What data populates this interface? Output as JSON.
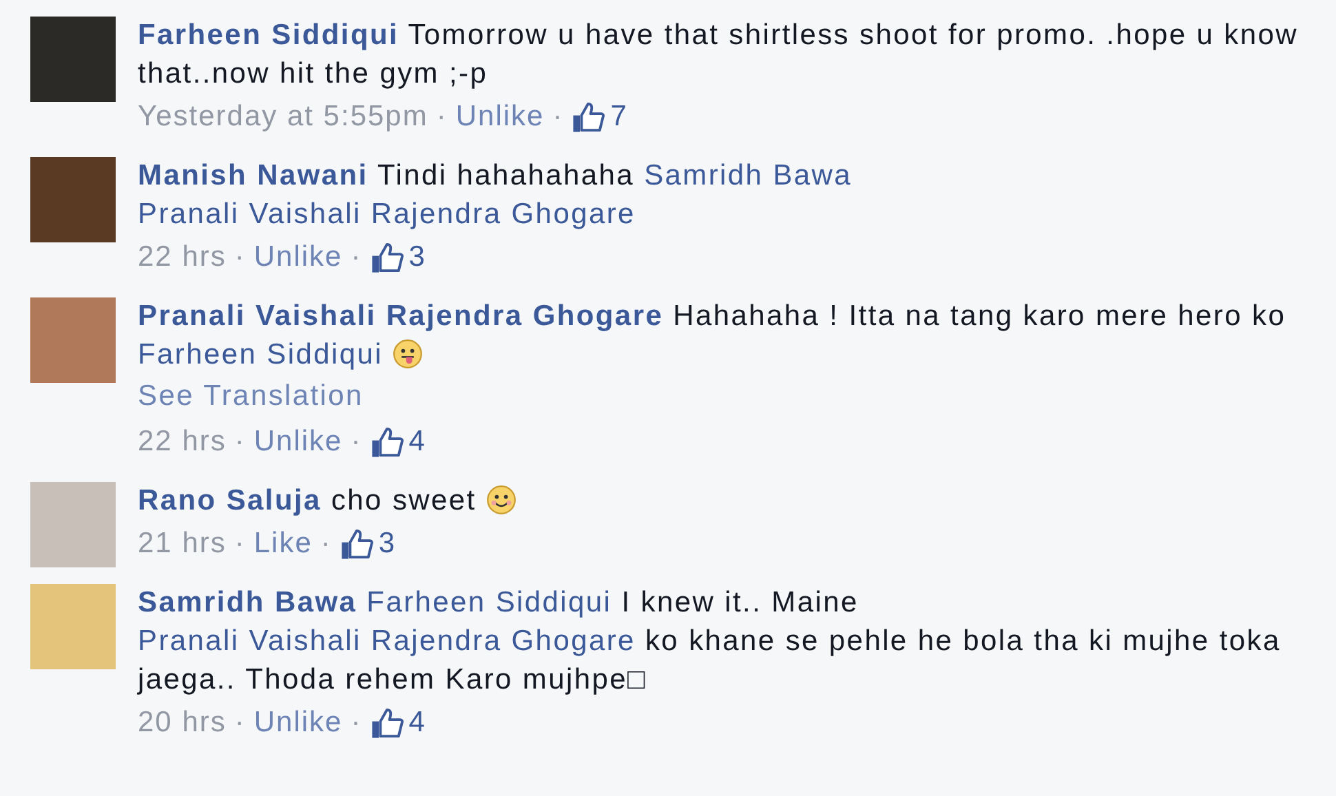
{
  "separator": "·",
  "comments": [
    {
      "author": "Farheen Siddiqui",
      "body": [
        {
          "kind": "text",
          "text": "Tomorrow u have that shirtless shoot for promo. .hope u know that..now hit the gym ;-p"
        }
      ],
      "time": "Yesterday at 5:55pm",
      "action": "Unlike",
      "likes": "7"
    },
    {
      "author": "Manish Nawani",
      "body": [
        {
          "kind": "text",
          "text": "Tindi hahahahaha"
        },
        {
          "kind": "mention",
          "text": "Samridh Bawa"
        },
        {
          "kind": "mention",
          "text": "Pranali Vaishali Rajendra Ghogare"
        }
      ],
      "time": "22 hrs",
      "action": "Unlike",
      "likes": "3"
    },
    {
      "author": "Pranali Vaishali Rajendra Ghogare",
      "body": [
        {
          "kind": "text",
          "text": "Hahahaha ! Itta na tang karo mere hero ko"
        },
        {
          "kind": "mention",
          "text": "Farheen Siddiqui"
        },
        {
          "kind": "tongue"
        }
      ],
      "see_translation": "See Translation",
      "time": "22 hrs",
      "action": "Unlike",
      "likes": "4"
    },
    {
      "author": "Rano Saluja",
      "body": [
        {
          "kind": "text",
          "text": "cho sweet"
        },
        {
          "kind": "smile"
        }
      ],
      "time": "21 hrs",
      "action": "Like",
      "likes": "3"
    },
    {
      "author": "Samridh Bawa",
      "body": [
        {
          "kind": "mention",
          "text": "Farheen Siddiqui"
        },
        {
          "kind": "text",
          "text": "I knew it.. Maine"
        },
        {
          "kind": "mention",
          "text": "Pranali Vaishali Rajendra Ghogare"
        },
        {
          "kind": "text",
          "text": "ko khane se pehle he bola tha ki mujhe toka jaega.. Thoda rehem Karo mujhpe□"
        }
      ],
      "time": "20 hrs",
      "action": "Unlike",
      "likes": "4"
    }
  ]
}
